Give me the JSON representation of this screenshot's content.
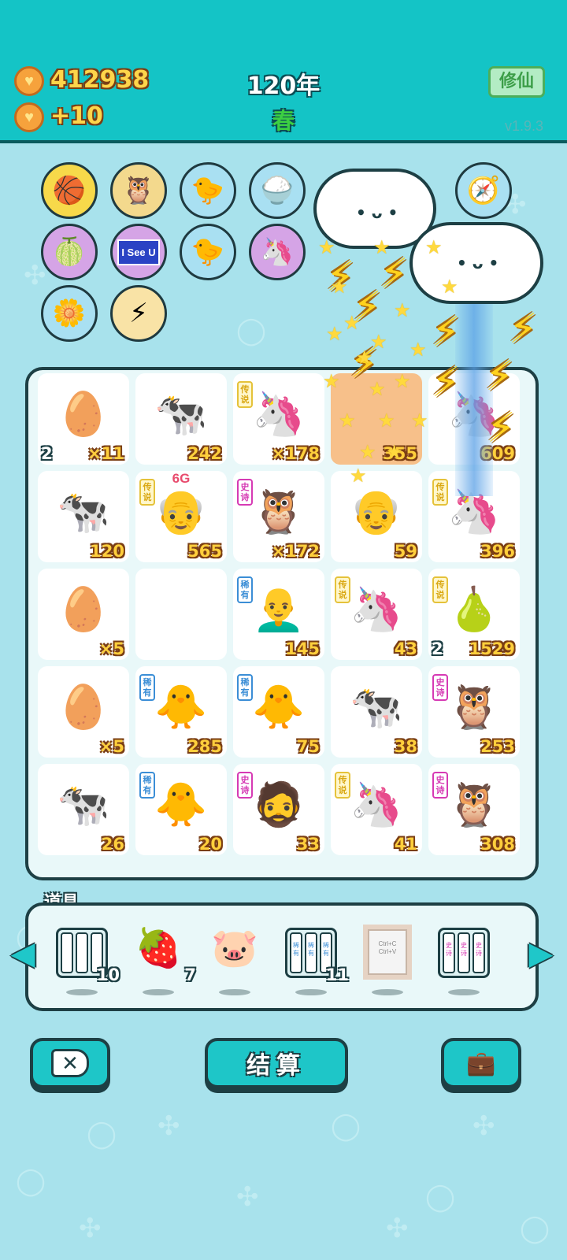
{
  "header": {
    "coins": "412938",
    "income": "+10",
    "year": "120年",
    "season": "春",
    "xiuxian_label": "修仙",
    "version": "v1.9.3"
  },
  "skills": [
    {
      "icon": "basketballs-icon",
      "glyph": "🏀",
      "bg": "#f7d94a"
    },
    {
      "icon": "owl-icon",
      "glyph": "🦉",
      "bg": "#f3d98d"
    },
    {
      "icon": "chick-egg-icon",
      "glyph": "🐤",
      "bg": "#a9e0f2"
    },
    {
      "icon": "rice-bowl-icon",
      "glyph": "🍚",
      "bg": "#a9e0f2"
    },
    {
      "icon": "compass-icon",
      "glyph": "🧭",
      "bg": "#a9e0f2"
    },
    {
      "icon": "grapefruit-icon",
      "glyph": "🍈",
      "bg": "#d5a4e6"
    },
    {
      "icon": "i-see-u-icon",
      "text": "I See U",
      "bg": "#d5a4e6"
    },
    {
      "icon": "chick-egg-icon",
      "glyph": "🐤",
      "bg": "#a9e0f2"
    },
    {
      "icon": "unicorn-pair-icon",
      "glyph": "🦄",
      "bg": "#d5a4e6"
    },
    {
      "icon": "potted-flower-icon",
      "glyph": "🌼",
      "bg": "#a9e0f2"
    },
    {
      "icon": "lightning-icon",
      "glyph": "⚡",
      "bg": "#f9e3a6"
    }
  ],
  "board": [
    {
      "icon": "egg-icon",
      "glyph": "🥚",
      "num": "×11",
      "lvl": "2"
    },
    {
      "icon": "cow-icon",
      "glyph": "🐄",
      "num": "242"
    },
    {
      "icon": "unicorn-icon",
      "glyph": "🦄",
      "num": "×178",
      "tag": "传说",
      "tagType": "legend"
    },
    {
      "icon": "hidden-item-icon",
      "glyph": "",
      "num": "355"
    },
    {
      "icon": "unicorn-icon",
      "glyph": "🦄",
      "num": "609"
    },
    {
      "icon": "cow-icon",
      "glyph": "🐄",
      "num": "120"
    },
    {
      "icon": "bald-man-glasses-icon",
      "glyph": "👴",
      "num": "565",
      "tag": "传说",
      "tagType": "legend",
      "extra": "6G"
    },
    {
      "icon": "owl-grandpa-icon",
      "glyph": "🦉",
      "num": "×172",
      "tag": "史诗",
      "tagType": "epic"
    },
    {
      "icon": "grandpa-glasses-icon",
      "glyph": "👴",
      "num": "59"
    },
    {
      "icon": "unicorn-icon",
      "glyph": "🦄",
      "num": "396",
      "tag": "传说",
      "tagType": "legend"
    },
    {
      "icon": "egg-icon",
      "glyph": "🥚",
      "num": "×5"
    },
    {
      "icon": "empty-slot",
      "glyph": "",
      "num": ""
    },
    {
      "icon": "bald-man-icon",
      "glyph": "👨‍🦲",
      "num": "145",
      "tag": "稀有",
      "tagType": "rare"
    },
    {
      "icon": "unicorn-icon",
      "glyph": "🦄",
      "num": "43",
      "tag": "传说",
      "tagType": "legend"
    },
    {
      "icon": "pear-icon",
      "glyph": "🍐",
      "num": "1529",
      "tag": "传说",
      "tagType": "legend",
      "lvl": "2"
    },
    {
      "icon": "egg-icon",
      "glyph": "🥚",
      "num": "×5"
    },
    {
      "icon": "chick-icon",
      "glyph": "🐥",
      "num": "285",
      "tag": "稀有",
      "tagType": "rare"
    },
    {
      "icon": "chick-icon",
      "glyph": "🐥",
      "num": "75",
      "tag": "稀有",
      "tagType": "rare"
    },
    {
      "icon": "cow-icon",
      "glyph": "🐄",
      "num": "38"
    },
    {
      "icon": "owl-grandpa-icon",
      "glyph": "🦉",
      "num": "253",
      "tag": "史诗",
      "tagType": "epic"
    },
    {
      "icon": "cow-icon",
      "glyph": "🐄",
      "num": "26"
    },
    {
      "icon": "chick-icon",
      "glyph": "🐥",
      "num": "20",
      "tag": "稀有",
      "tagType": "rare"
    },
    {
      "icon": "green-hat-man-icon",
      "glyph": "🧔",
      "num": "33",
      "tag": "史诗",
      "tagType": "epic"
    },
    {
      "icon": "unicorn-icon",
      "glyph": "🦄",
      "num": "41",
      "tag": "传说",
      "tagType": "legend"
    },
    {
      "icon": "owl-grandpa-icon",
      "glyph": "🦉",
      "num": "308",
      "tag": "史诗",
      "tagType": "epic"
    }
  ],
  "props": {
    "label": "道具",
    "items": [
      {
        "icon": "empty-tray-icon",
        "type": "tray",
        "slots": [
          "",
          "",
          ""
        ],
        "count": "10"
      },
      {
        "icon": "strawberry-icon",
        "type": "glyph",
        "glyph": "🍓",
        "count": "7"
      },
      {
        "icon": "piggy-bank-icon",
        "type": "glyph",
        "glyph": "🐷",
        "count": ""
      },
      {
        "icon": "rare-tray-icon",
        "type": "tray",
        "slots": [
          "稀有",
          "稀有",
          "稀有"
        ],
        "count": "11"
      },
      {
        "icon": "copy-paste-frame-icon",
        "type": "frame",
        "lines": [
          "Ctrl+C",
          "Ctrl+V"
        ],
        "count": ""
      },
      {
        "icon": "epic-tray-icon",
        "type": "tray",
        "epic": true,
        "slots": [
          "史诗",
          "史诗",
          "史诗"
        ],
        "count": ""
      }
    ]
  },
  "buttons": {
    "settle_label": "结算"
  },
  "colors": {
    "header": "#14c4c6",
    "background": "#a8e2ec",
    "rare": "#3b8ed6",
    "legend": "#d9a712",
    "epic": "#d63ab4"
  }
}
